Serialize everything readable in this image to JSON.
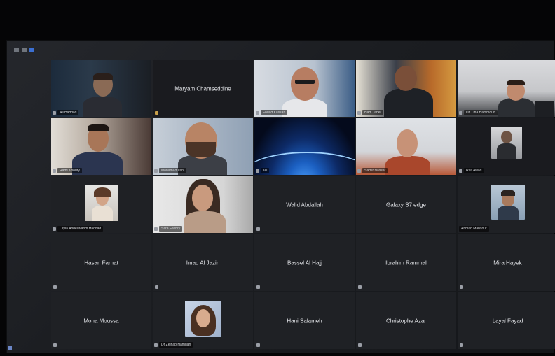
{
  "window": {
    "controls": [
      "minimize-icon",
      "restore-icon",
      "close-icon"
    ],
    "control_colors": [
      "#6f747c",
      "#6f747c",
      "#3b6fd2"
    ]
  },
  "participants": [
    {
      "label": "Ali Haddad",
      "type": "video",
      "active": true
    },
    {
      "center_name": "Maryam Chamseddine",
      "type": "name"
    },
    {
      "label": "Fouad Kassab",
      "type": "video"
    },
    {
      "label": "Hadi Jaber",
      "type": "video"
    },
    {
      "label": "Dr. Lina Hammoud",
      "type": "video"
    },
    {
      "label": "Rami Khoury",
      "type": "video"
    },
    {
      "label": "Mohamad Itani",
      "type": "video"
    },
    {
      "label": "Tel",
      "type": "video"
    },
    {
      "label": "Samir Nassar",
      "type": "video"
    },
    {
      "label": "Rita Awad",
      "type": "thumb"
    },
    {
      "label": "Layla Abdel Karim Haddad",
      "type": "thumb"
    },
    {
      "label": "Sara Fakhry",
      "type": "video"
    },
    {
      "center_name": "Walid Abdallah",
      "type": "name"
    },
    {
      "center_name": "Galaxy S7 edge",
      "type": "name"
    },
    {
      "label": "Ahmad Mansour",
      "type": "thumb"
    },
    {
      "center_name": "Hasan Farhat",
      "type": "name"
    },
    {
      "center_name": "Imad Al Jaziri",
      "type": "name"
    },
    {
      "center_name": "Bassel Al Hajj",
      "type": "name"
    },
    {
      "center_name": "Ibrahim Rammal",
      "type": "name"
    },
    {
      "center_name": "Mira Hayek",
      "type": "name"
    },
    {
      "center_name": "Mona Moussa",
      "type": "name"
    },
    {
      "label": "Dr Zeinab Hamdan",
      "type": "thumb"
    },
    {
      "center_name": "Hani Salameh",
      "type": "name"
    },
    {
      "center_name": "Christophe Azar",
      "type": "name"
    },
    {
      "center_name": "Layal Fayad",
      "type": "name"
    }
  ]
}
